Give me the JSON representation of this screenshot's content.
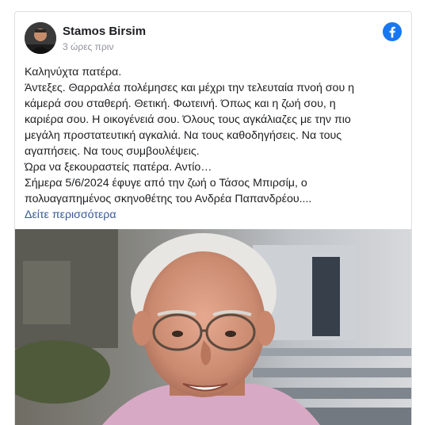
{
  "post": {
    "author": "Stamos Birsim",
    "time": "3 ώρες πριν",
    "lines": [
      "Καληνύχτα πατέρα.",
      "Άντεξες. Θαρραλέα πολέμησες και μέχρι την τελευταία πνοή σου η",
      "κάμερά σου σταθερή. Θετική. Φωτεινή. Όπως και η ζωή σου, η",
      "καριέρα σου. Η οικογένειά σου. Όλους τους αγκάλιαζες με την πιο",
      "μεγάλη προστατευτική αγκαλιά. Να τους καθοδηγήσεις. Να τους",
      "αγαπήσεις. Να τους συμβουλέψεις.",
      "Ώρα να ξεκουραστείς πατέρα. Αντίο…",
      "Σήμερα 5/6/2024 έφυγε από την ζωή ο Τάσος Μπιρσίμ, ο",
      "πολυαγαπημένος σκηνοθέτης του Ανδρέα Παπανδρέου...."
    ],
    "see_more": "Δείτε περισσότερα"
  },
  "colors": {
    "facebook": "#1877f2",
    "link": "#385898"
  },
  "icons": {
    "brand": "facebook-icon"
  }
}
